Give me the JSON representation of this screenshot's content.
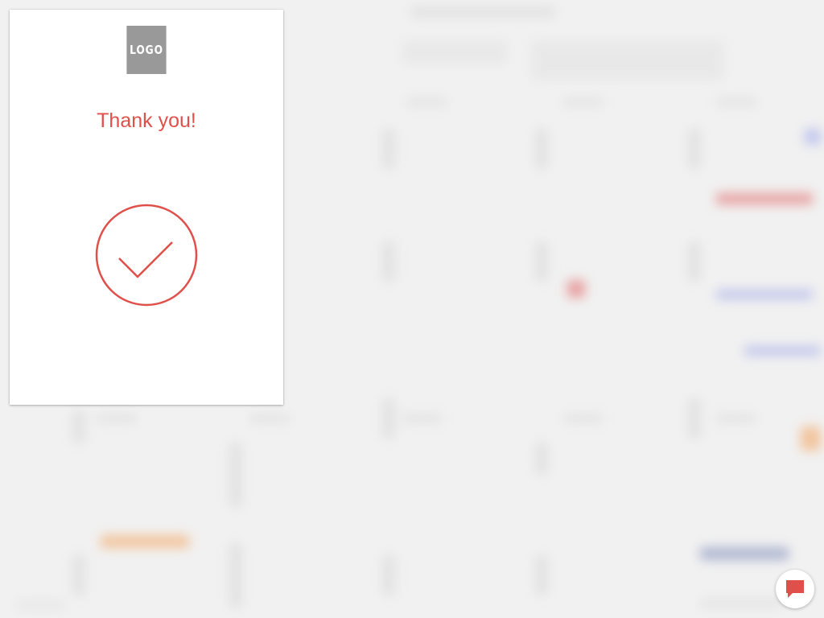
{
  "card": {
    "logo_text": "LOGO",
    "title": "Thank you!"
  },
  "icons": {
    "success": "check-circle-icon",
    "chat": "chat-bubble-icon"
  },
  "colors": {
    "accent": "#e0504b",
    "logo_bg": "#999999",
    "backdrop": "#f1f1f1"
  }
}
